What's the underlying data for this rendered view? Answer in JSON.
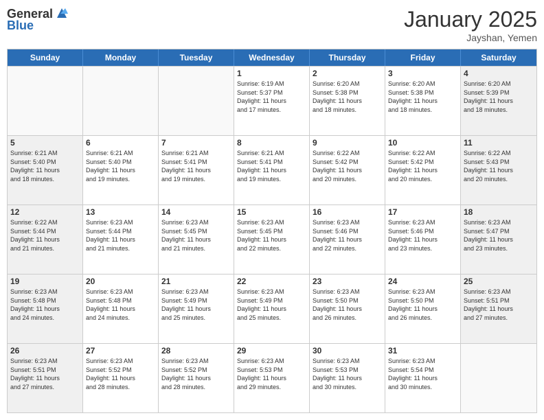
{
  "header": {
    "logo_line1": "General",
    "logo_line2": "Blue",
    "month_title": "January 2025",
    "subtitle": "Jayshan, Yemen"
  },
  "days_of_week": [
    "Sunday",
    "Monday",
    "Tuesday",
    "Wednesday",
    "Thursday",
    "Friday",
    "Saturday"
  ],
  "rows": [
    [
      {
        "day": "",
        "lines": []
      },
      {
        "day": "",
        "lines": []
      },
      {
        "day": "",
        "lines": []
      },
      {
        "day": "1",
        "lines": [
          "Sunrise: 6:19 AM",
          "Sunset: 5:37 PM",
          "Daylight: 11 hours",
          "and 17 minutes."
        ]
      },
      {
        "day": "2",
        "lines": [
          "Sunrise: 6:20 AM",
          "Sunset: 5:38 PM",
          "Daylight: 11 hours",
          "and 18 minutes."
        ]
      },
      {
        "day": "3",
        "lines": [
          "Sunrise: 6:20 AM",
          "Sunset: 5:38 PM",
          "Daylight: 11 hours",
          "and 18 minutes."
        ]
      },
      {
        "day": "4",
        "lines": [
          "Sunrise: 6:20 AM",
          "Sunset: 5:39 PM",
          "Daylight: 11 hours",
          "and 18 minutes."
        ]
      }
    ],
    [
      {
        "day": "5",
        "lines": [
          "Sunrise: 6:21 AM",
          "Sunset: 5:40 PM",
          "Daylight: 11 hours",
          "and 18 minutes."
        ]
      },
      {
        "day": "6",
        "lines": [
          "Sunrise: 6:21 AM",
          "Sunset: 5:40 PM",
          "Daylight: 11 hours",
          "and 19 minutes."
        ]
      },
      {
        "day": "7",
        "lines": [
          "Sunrise: 6:21 AM",
          "Sunset: 5:41 PM",
          "Daylight: 11 hours",
          "and 19 minutes."
        ]
      },
      {
        "day": "8",
        "lines": [
          "Sunrise: 6:21 AM",
          "Sunset: 5:41 PM",
          "Daylight: 11 hours",
          "and 19 minutes."
        ]
      },
      {
        "day": "9",
        "lines": [
          "Sunrise: 6:22 AM",
          "Sunset: 5:42 PM",
          "Daylight: 11 hours",
          "and 20 minutes."
        ]
      },
      {
        "day": "10",
        "lines": [
          "Sunrise: 6:22 AM",
          "Sunset: 5:42 PM",
          "Daylight: 11 hours",
          "and 20 minutes."
        ]
      },
      {
        "day": "11",
        "lines": [
          "Sunrise: 6:22 AM",
          "Sunset: 5:43 PM",
          "Daylight: 11 hours",
          "and 20 minutes."
        ]
      }
    ],
    [
      {
        "day": "12",
        "lines": [
          "Sunrise: 6:22 AM",
          "Sunset: 5:44 PM",
          "Daylight: 11 hours",
          "and 21 minutes."
        ]
      },
      {
        "day": "13",
        "lines": [
          "Sunrise: 6:23 AM",
          "Sunset: 5:44 PM",
          "Daylight: 11 hours",
          "and 21 minutes."
        ]
      },
      {
        "day": "14",
        "lines": [
          "Sunrise: 6:23 AM",
          "Sunset: 5:45 PM",
          "Daylight: 11 hours",
          "and 21 minutes."
        ]
      },
      {
        "day": "15",
        "lines": [
          "Sunrise: 6:23 AM",
          "Sunset: 5:45 PM",
          "Daylight: 11 hours",
          "and 22 minutes."
        ]
      },
      {
        "day": "16",
        "lines": [
          "Sunrise: 6:23 AM",
          "Sunset: 5:46 PM",
          "Daylight: 11 hours",
          "and 22 minutes."
        ]
      },
      {
        "day": "17",
        "lines": [
          "Sunrise: 6:23 AM",
          "Sunset: 5:46 PM",
          "Daylight: 11 hours",
          "and 23 minutes."
        ]
      },
      {
        "day": "18",
        "lines": [
          "Sunrise: 6:23 AM",
          "Sunset: 5:47 PM",
          "Daylight: 11 hours",
          "and 23 minutes."
        ]
      }
    ],
    [
      {
        "day": "19",
        "lines": [
          "Sunrise: 6:23 AM",
          "Sunset: 5:48 PM",
          "Daylight: 11 hours",
          "and 24 minutes."
        ]
      },
      {
        "day": "20",
        "lines": [
          "Sunrise: 6:23 AM",
          "Sunset: 5:48 PM",
          "Daylight: 11 hours",
          "and 24 minutes."
        ]
      },
      {
        "day": "21",
        "lines": [
          "Sunrise: 6:23 AM",
          "Sunset: 5:49 PM",
          "Daylight: 11 hours",
          "and 25 minutes."
        ]
      },
      {
        "day": "22",
        "lines": [
          "Sunrise: 6:23 AM",
          "Sunset: 5:49 PM",
          "Daylight: 11 hours",
          "and 25 minutes."
        ]
      },
      {
        "day": "23",
        "lines": [
          "Sunrise: 6:23 AM",
          "Sunset: 5:50 PM",
          "Daylight: 11 hours",
          "and 26 minutes."
        ]
      },
      {
        "day": "24",
        "lines": [
          "Sunrise: 6:23 AM",
          "Sunset: 5:50 PM",
          "Daylight: 11 hours",
          "and 26 minutes."
        ]
      },
      {
        "day": "25",
        "lines": [
          "Sunrise: 6:23 AM",
          "Sunset: 5:51 PM",
          "Daylight: 11 hours",
          "and 27 minutes."
        ]
      }
    ],
    [
      {
        "day": "26",
        "lines": [
          "Sunrise: 6:23 AM",
          "Sunset: 5:51 PM",
          "Daylight: 11 hours",
          "and 27 minutes."
        ]
      },
      {
        "day": "27",
        "lines": [
          "Sunrise: 6:23 AM",
          "Sunset: 5:52 PM",
          "Daylight: 11 hours",
          "and 28 minutes."
        ]
      },
      {
        "day": "28",
        "lines": [
          "Sunrise: 6:23 AM",
          "Sunset: 5:52 PM",
          "Daylight: 11 hours",
          "and 28 minutes."
        ]
      },
      {
        "day": "29",
        "lines": [
          "Sunrise: 6:23 AM",
          "Sunset: 5:53 PM",
          "Daylight: 11 hours",
          "and 29 minutes."
        ]
      },
      {
        "day": "30",
        "lines": [
          "Sunrise: 6:23 AM",
          "Sunset: 5:53 PM",
          "Daylight: 11 hours",
          "and 30 minutes."
        ]
      },
      {
        "day": "31",
        "lines": [
          "Sunrise: 6:23 AM",
          "Sunset: 5:54 PM",
          "Daylight: 11 hours",
          "and 30 minutes."
        ]
      },
      {
        "day": "",
        "lines": []
      }
    ]
  ]
}
